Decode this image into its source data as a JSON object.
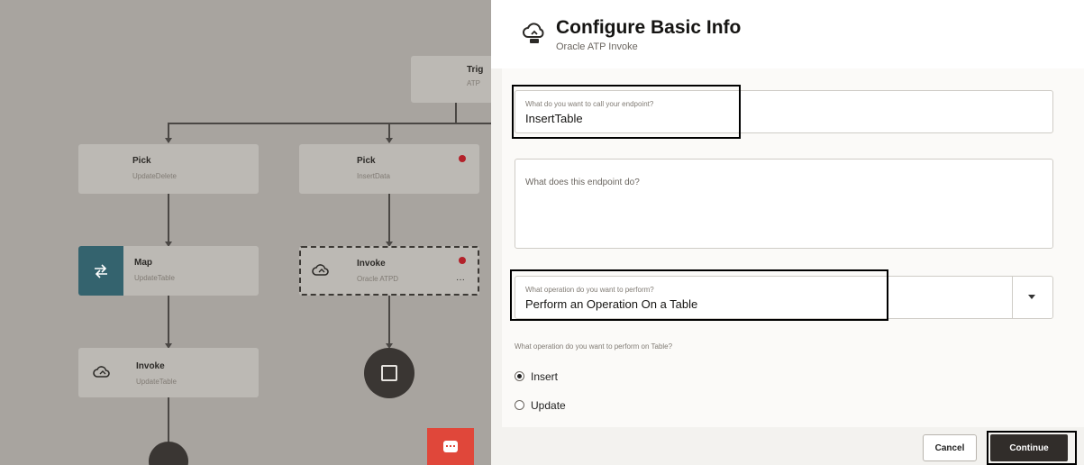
{
  "canvas": {
    "trigger": {
      "title": "Trig",
      "subtitle": "ATP"
    },
    "pick1": {
      "title": "Pick",
      "subtitle": "UpdateDelete"
    },
    "pick2": {
      "title": "Pick",
      "subtitle": "InsertData"
    },
    "map": {
      "title": "Map",
      "subtitle": "UpdateTable"
    },
    "invoke_selected": {
      "title": "Invoke",
      "subtitle": "Oracle ATPD",
      "more": "···"
    },
    "invoke2": {
      "title": "Invoke",
      "subtitle": "UpdateTable"
    }
  },
  "drawer": {
    "title": "Configure Basic Info",
    "subtitle": "Oracle ATP Invoke",
    "endpoint_name": {
      "label": "What do you want to call your endpoint?",
      "value": "InsertTable"
    },
    "endpoint_desc": {
      "placeholder": "What does this endpoint do?"
    },
    "operation": {
      "label": "What operation do you want to perform?",
      "value": "Perform an Operation On a Table"
    },
    "table_op": {
      "label": "What operation do you want to perform on Table?",
      "options": [
        {
          "label": "Insert",
          "selected": true
        },
        {
          "label": "Update",
          "selected": false
        }
      ]
    },
    "cancel_label": "Cancel",
    "continue_label": "Continue"
  },
  "colors": {
    "accent_teal": "#34636e",
    "chat_red": "#e0473a",
    "error_dot": "#b3212a"
  }
}
